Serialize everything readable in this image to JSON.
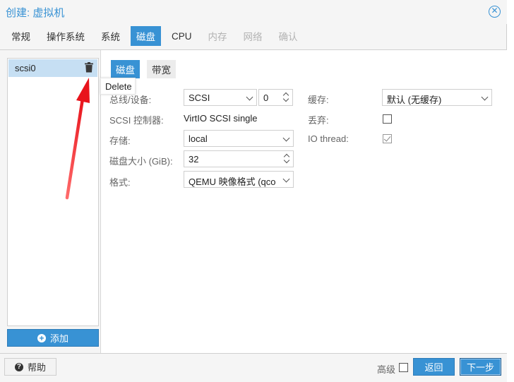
{
  "window": {
    "title": "创建: 虚拟机"
  },
  "tabs": [
    {
      "label": "常规",
      "state": "normal"
    },
    {
      "label": "操作系统",
      "state": "normal"
    },
    {
      "label": "系统",
      "state": "normal"
    },
    {
      "label": "磁盘",
      "state": "active"
    },
    {
      "label": "CPU",
      "state": "normal"
    },
    {
      "label": "内存",
      "state": "disabled"
    },
    {
      "label": "网络",
      "state": "disabled"
    },
    {
      "label": "确认",
      "state": "disabled"
    }
  ],
  "disk_list": {
    "items": [
      {
        "label": "scsi0"
      }
    ],
    "add_label": "添加"
  },
  "tooltip": "Delete",
  "subtabs": [
    {
      "label": "磁盘",
      "state": "active"
    },
    {
      "label": "带宽",
      "state": "normal"
    }
  ],
  "form": {
    "bus_label": "总线/设备:",
    "bus_value": "SCSI",
    "device_value": "0",
    "controller_label": "SCSI 控制器:",
    "controller_value": "VirtIO SCSI single",
    "storage_label": "存储:",
    "storage_value": "local",
    "size_label": "磁盘大小 (GiB):",
    "size_value": "32",
    "format_label": "格式:",
    "format_value": "QEMU 映像格式 (qco",
    "cache_label": "缓存:",
    "cache_value": "默认 (无缓存)",
    "discard_label": "丢弃:",
    "discard_checked": false,
    "iothread_label": "IO thread:",
    "iothread_checked": true
  },
  "footer": {
    "help_label": "帮助",
    "advanced_label": "高级",
    "advanced_checked": false,
    "back_label": "返回",
    "next_label": "下一步"
  },
  "colors": {
    "accent": "#3892d4",
    "selected_row": "#c6dff3",
    "annotation_arrow": "#e8141c"
  }
}
